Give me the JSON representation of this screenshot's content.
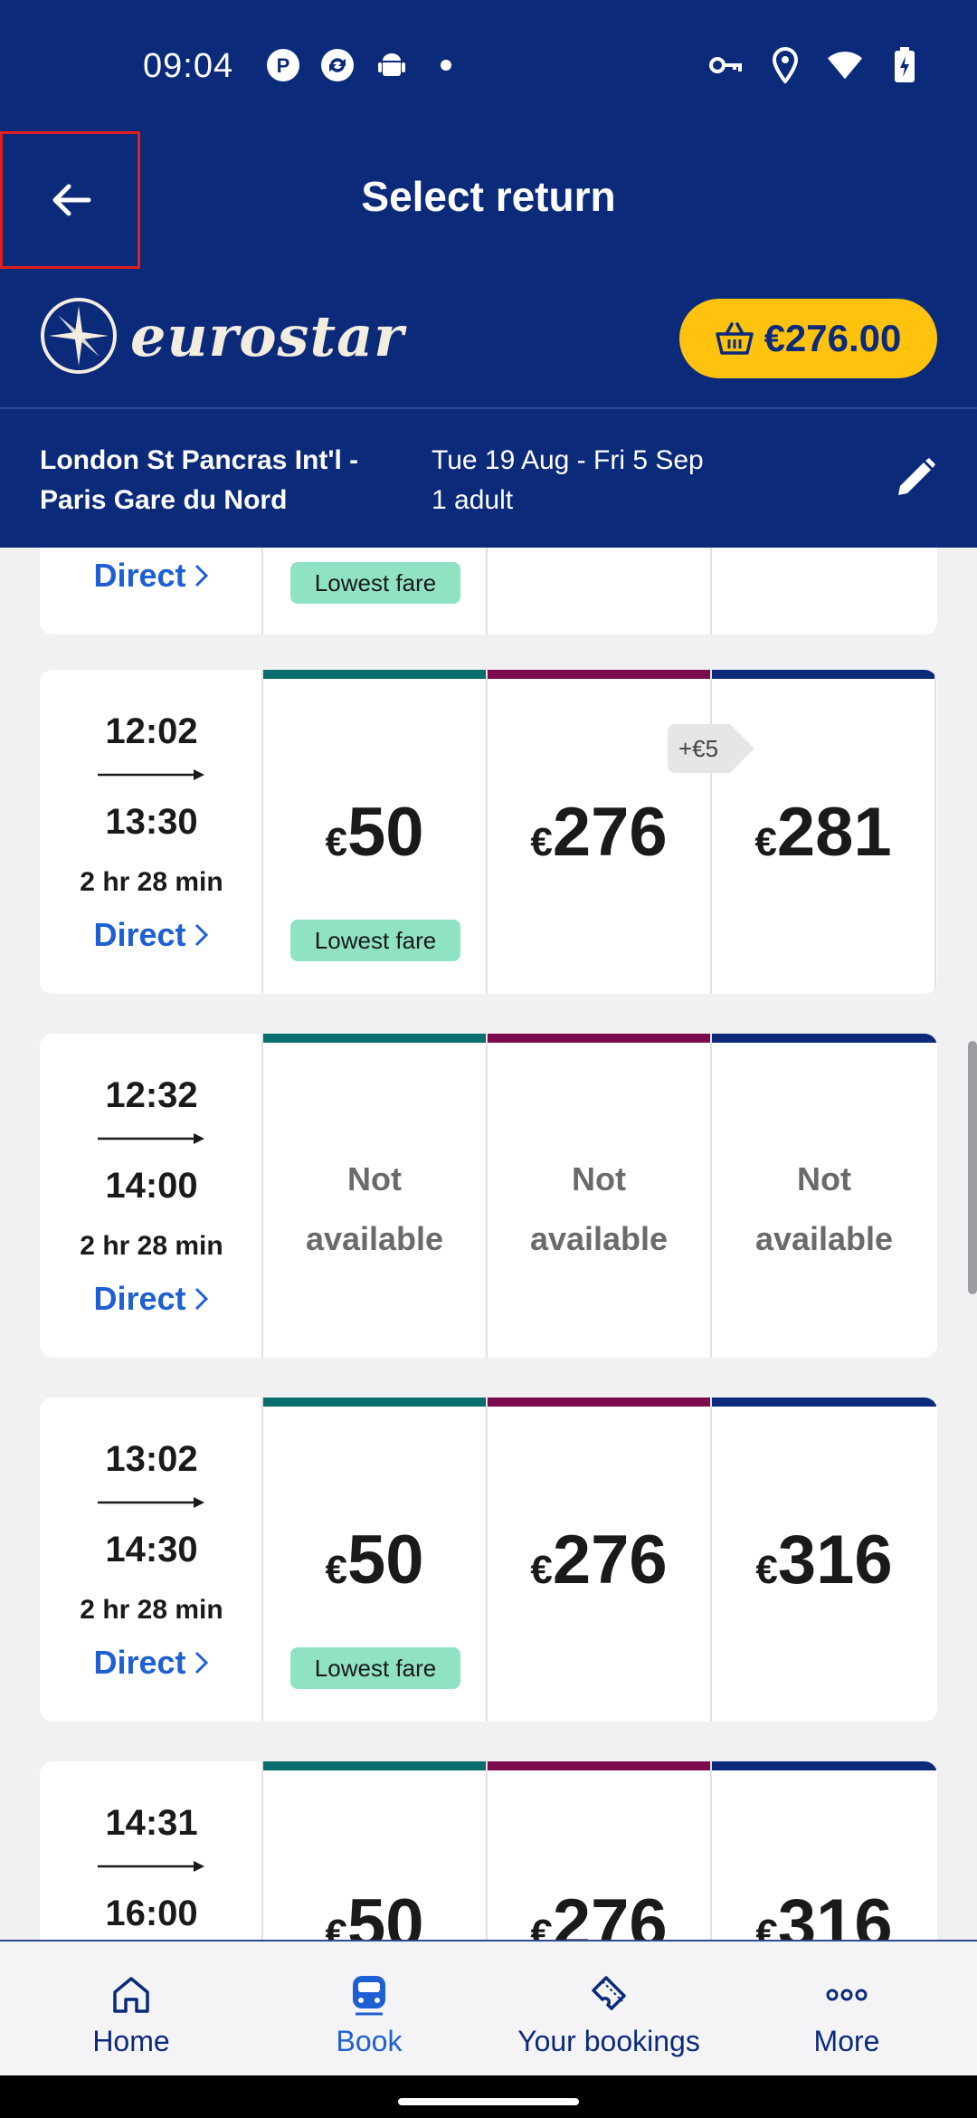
{
  "status_bar": {
    "time": "09:04"
  },
  "header": {
    "title": "Select return",
    "brand": "eurostar",
    "basket_total": "€276.00"
  },
  "journey": {
    "route_line1": "London St Pancras Int'l -",
    "route_line2": "Paris Gare du Nord",
    "dates": "Tue 19 Aug - Fri 5 Sep",
    "passengers": "1 adult"
  },
  "partial_card": {
    "direct": "Direct",
    "lowest": "Lowest fare"
  },
  "trains": [
    {
      "depart": "12:02",
      "arrive": "13:30",
      "duration": "2 hr 28 min",
      "type": "Direct",
      "fares": [
        {
          "currency": "€",
          "amount": "50",
          "badge": "Lowest fare"
        },
        {
          "currency": "€",
          "amount": "276"
        },
        {
          "currency": "€",
          "amount": "281"
        }
      ],
      "upsell": "+€5"
    },
    {
      "depart": "12:32",
      "arrive": "14:00",
      "duration": "2 hr 28 min",
      "type": "Direct",
      "fares": [
        {
          "na1": "Not",
          "na2": "available"
        },
        {
          "na1": "Not",
          "na2": "available"
        },
        {
          "na1": "Not",
          "na2": "available"
        }
      ]
    },
    {
      "depart": "13:02",
      "arrive": "14:30",
      "duration": "2 hr 28 min",
      "type": "Direct",
      "fares": [
        {
          "currency": "€",
          "amount": "50",
          "badge": "Lowest fare"
        },
        {
          "currency": "€",
          "amount": "276"
        },
        {
          "currency": "€",
          "amount": "316"
        }
      ]
    },
    {
      "depart": "14:31",
      "arrive": "16:00",
      "fares": [
        {
          "currency": "€",
          "amount": "50"
        },
        {
          "currency": "€",
          "amount": "276"
        },
        {
          "currency": "€",
          "amount": "316"
        }
      ]
    }
  ],
  "bottom_nav": [
    {
      "label": "Home",
      "icon": "home-icon"
    },
    {
      "label": "Book",
      "icon": "train-icon",
      "active": true
    },
    {
      "label": "Your bookings",
      "icon": "ticket-icon"
    },
    {
      "label": "More",
      "icon": "more-icon"
    }
  ],
  "colors": {
    "header": "#0b2a7a",
    "accent_yellow": "#ffc20e",
    "standard": "#0a6d6e",
    "plus": "#7c0b4e",
    "premier": "#0b2a7a",
    "link": "#1e5fd3",
    "lowest_badge": "#8fe3c2"
  }
}
